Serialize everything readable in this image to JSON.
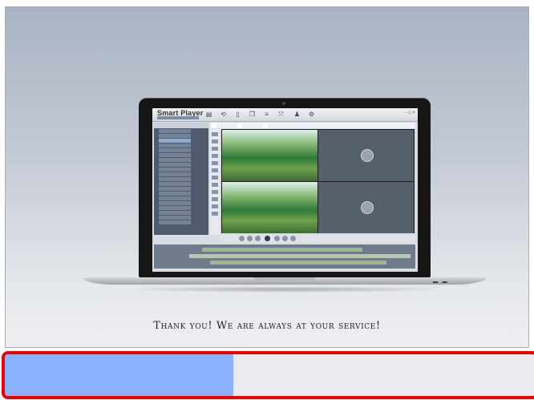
{
  "app": {
    "title": "Smart Player",
    "window_controls": "- □ ×"
  },
  "message": "Thank you! We are always at your service!",
  "progress": {
    "fraction": 0.43,
    "fill_color": "#8ab2ff",
    "border_color": "#ee0000"
  },
  "icons": {
    "toolbar": [
      "folder-icon",
      "refresh-icon",
      "document-icon",
      "copy-icon",
      "list-icon",
      "fullscreen-icon",
      "user-icon",
      "settings-icon"
    ],
    "play": "play-icon"
  }
}
